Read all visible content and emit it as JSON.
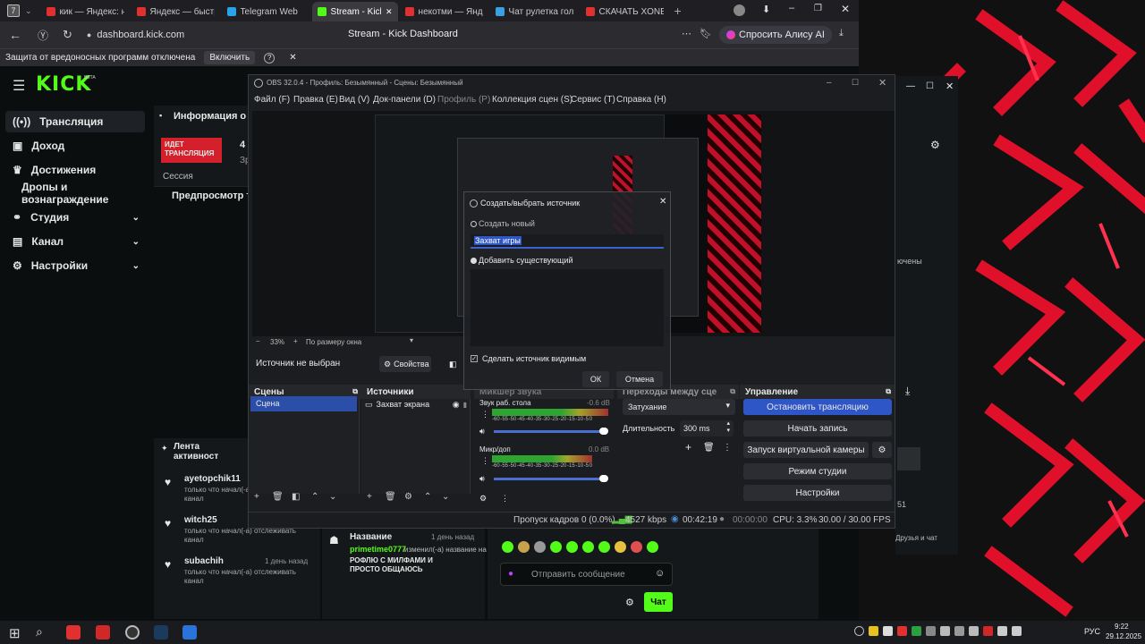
{
  "browser": {
    "tabs": [
      {
        "label": "кик — Яндекс: на",
        "color": "#e03030"
      },
      {
        "label": "Яндекс — быстр",
        "color": "#e03030"
      },
      {
        "label": "Telegram Web",
        "color": "#2aa3e6"
      },
      {
        "label": "Stream - Kick D",
        "color": "#53fc18",
        "active": true
      },
      {
        "label": "некотми — Яндекс",
        "color": "#e03030"
      },
      {
        "label": "Чат рулетка голо",
        "color": "#3aa0e0"
      },
      {
        "label": "СКАЧАТЬ XONE",
        "color": "#e03030"
      }
    ],
    "tab_count": "7",
    "url": "dashboard.kick.com",
    "page_title": "Stream - Kick Dashboard",
    "alice": "Спросить Алису AI",
    "warning": "Защита от вредоносных программ отключена",
    "enable": "Включить"
  },
  "kick": {
    "logo": "KICK",
    "logo_badge": "BETA",
    "nav": [
      {
        "label": "Трансляция",
        "icon": "broadcast-icon"
      },
      {
        "label": "Доход",
        "icon": "money-icon"
      },
      {
        "label": "Достижения",
        "icon": "trophy-icon"
      },
      {
        "label": "Дропы и вознаграждение",
        "icon": ""
      },
      {
        "label": "Студия",
        "icon": "studio-icon"
      },
      {
        "label": "Канал",
        "icon": "channel-icon"
      },
      {
        "label": "Настройки",
        "icon": "settings-icon"
      }
    ],
    "info_title": "Информация о се",
    "live_badge": "ИДЕТ ТРАНСЛЯЦИЯ",
    "stat_value": "4",
    "stat_suffix": "Зр",
    "session": "Сессия",
    "preview": "Предпросмотр тр",
    "feed_title": "Лента активност",
    "feed": [
      {
        "user": "ayetopchik11",
        "text": "только что начал(-а) отслеживать канал"
      },
      {
        "user": "witch25",
        "text": "только что начал(-а) отслеживать канал"
      },
      {
        "user": "subachih",
        "time": "1 день назад",
        "text": "только что начал(-а) отслеживать канал"
      }
    ],
    "title_event": {
      "label": "Название",
      "time": "1 день назад",
      "user": "primetime0777",
      "text": "изменил(-а) название на",
      "new_title": "РОФЛЮ С МИЛФАМИ И ПРОСТО ОБЩАЮСЬ"
    },
    "chat_placeholder": "Отправить сообщение",
    "chat_button": "Чат",
    "right_panel_text": "ючены",
    "right_footer": "Друзья и чат",
    "right_num": "51"
  },
  "obs": {
    "title": "OBS 32.0.4 - Профиль: Безымянный - Сцены: Безымянный",
    "menu": [
      "Файл (F)",
      "Правка (E)",
      "Вид (V)",
      "Док-панели (D)",
      "Профиль (P)",
      "Коллекция сцен (S)",
      "Сервис (T)",
      "Справка (H)"
    ],
    "zoom": "33%",
    "fit": "По размеру окна",
    "no_source": "Источник не выбран",
    "properties": "Свойства",
    "docks": {
      "scenes": "Сцены",
      "sources": "Источники",
      "mixer": "Микшер звука",
      "transitions": "Переходы между сце",
      "controls": "Управление"
    },
    "scene": "Сцена",
    "source": "Захват экрана",
    "mixer": [
      {
        "name": "Звук раб. стола",
        "db": "-0.6 dB"
      },
      {
        "name": "Микр/доп",
        "db": "0.0 dB"
      }
    ],
    "meter_scale": "-60 -55 -50 -45 -40 -35 -30 -25 -20 -15 -10 -5 0",
    "transition": "Затухание",
    "duration_label": "Длительность",
    "duration_value": "300 ms",
    "controls": [
      "Остановить трансляцию",
      "Начать запись",
      "Запуск виртуальной камеры",
      "Режим студии",
      "Настройки"
    ],
    "status": {
      "dropped": "Пропуск кадров 0 (0.0%)",
      "bitrate": "4527 kbps",
      "live_time": "00:42:19",
      "rec_time": "00:00:00",
      "cpu": "CPU: 3.3%",
      "fps": "30.00 / 30.00 FPS"
    }
  },
  "dialog": {
    "title": "Создать/выбрать источник",
    "create_new": "Создать новый",
    "name_value": "Захват игры",
    "add_existing": "Добавить существующий",
    "make_visible": "Сделать источник видимым",
    "ok": "ОК",
    "cancel": "Отмена"
  },
  "taskbar": {
    "lang": "РУС",
    "time": "9:22",
    "date": "29.12.2025"
  }
}
